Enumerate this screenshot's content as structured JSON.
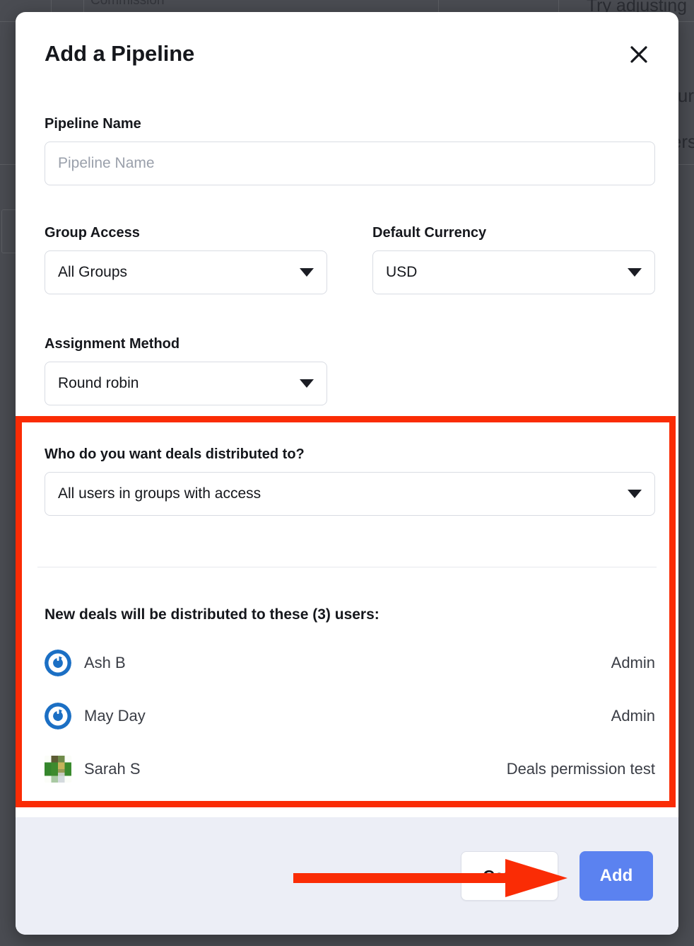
{
  "background": {
    "column_label": "Commission",
    "empty_state_text": "Try adjusting",
    "empty_state_text2": "your",
    "empty_state_text3": "filters"
  },
  "modal": {
    "title": "Add a Pipeline",
    "close_icon": "close-icon",
    "fields": {
      "pipeline_name": {
        "label": "Pipeline Name",
        "placeholder": "Pipeline Name",
        "value": ""
      },
      "group_access": {
        "label": "Group Access",
        "selected": "All Groups"
      },
      "default_currency": {
        "label": "Default Currency",
        "selected": "USD"
      },
      "assignment_method": {
        "label": "Assignment Method",
        "selected": "Round robin"
      },
      "distribution": {
        "label": "Who do you want deals distributed to?",
        "selected": "All users in groups with access"
      }
    },
    "users_section": {
      "heading": "New deals will be distributed to these (3) users:",
      "count": 3,
      "rows": [
        {
          "name": "Ash B",
          "role": "Admin",
          "avatar": "blue-spiral-avatar"
        },
        {
          "name": "May Day",
          "role": "Admin",
          "avatar": "blue-spiral-avatar"
        },
        {
          "name": "Sarah S",
          "role": "Deals permission test",
          "avatar": "green-pixel-avatar"
        }
      ]
    },
    "footer": {
      "cancel_label": "Cancel",
      "add_label": "Add"
    }
  },
  "annotations": {
    "highlight_color": "#fa2c05",
    "arrow_color": "#fa2c05",
    "highlight_target": "distribution-and-users-section",
    "arrow_target": "add-button"
  },
  "colors": {
    "accent_blue": "#5b82f0",
    "footer_background": "#eceef6",
    "backdrop": "#4a4c52",
    "text_primary": "#15171c"
  }
}
